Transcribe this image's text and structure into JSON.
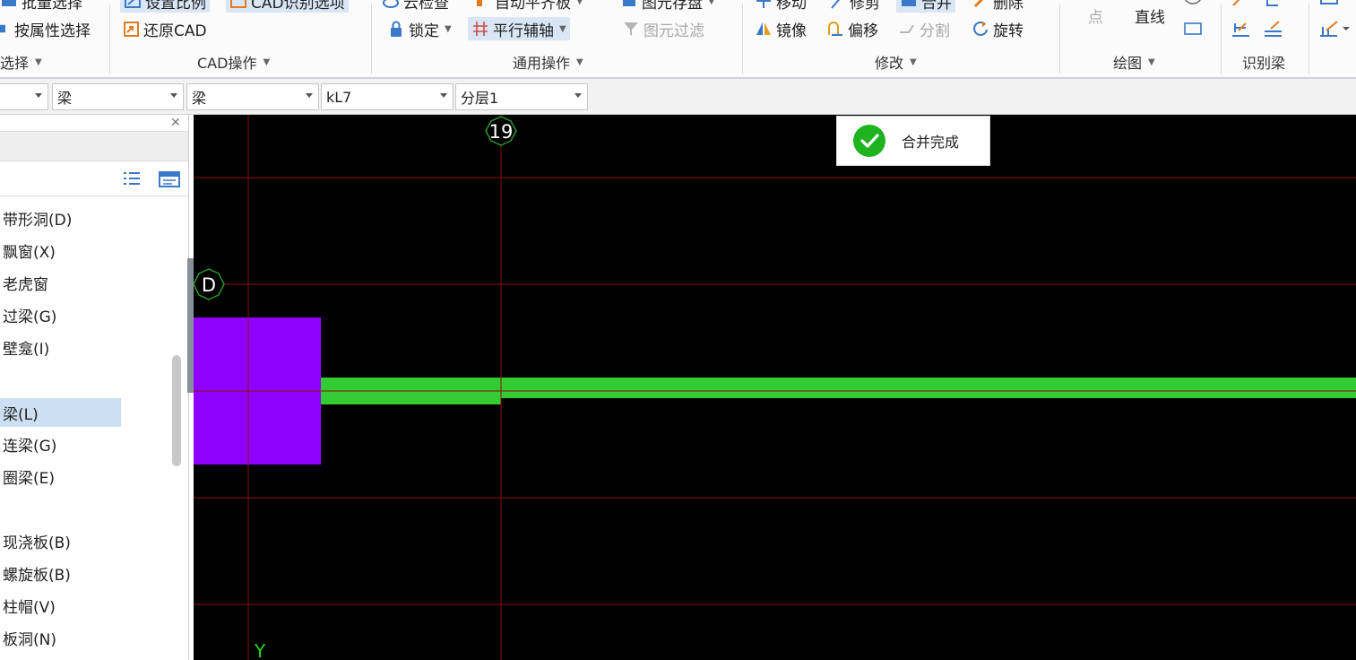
{
  "ribbon": {
    "col1": {
      "top_label": "批量选择",
      "attr_select": "按属性选择",
      "group_label": "选择"
    },
    "col2": {
      "top_label": "设置比例",
      "top_label2": "CAD识别选项",
      "restore": "还原CAD",
      "group_label": "CAD操作"
    },
    "col3": {
      "top_label": "云检查",
      "top_label2": "自动平齐板",
      "top_label3": "图元存盘",
      "lock": "锁定",
      "parallel_axis": "平行辅轴",
      "filter": "图元过滤",
      "group_label": "通用操作"
    },
    "col4": {
      "top_move": "移动",
      "top_trim": "修剪",
      "top_merge": "合并",
      "top_delete": "删除",
      "mirror": "镜像",
      "offset": "偏移",
      "split": "分割",
      "rotate": "旋转",
      "group_label": "修改"
    },
    "col5": {
      "point": "点",
      "line": "直线",
      "group_label": "绘图"
    },
    "col6": {
      "group_label": "识别梁"
    }
  },
  "toolbar2": {
    "combo1": "",
    "combo2": "梁",
    "combo3": "梁",
    "combo4": "kL7",
    "combo5": "分层1"
  },
  "panel": {
    "items": [
      {
        "label": "带形洞(D)"
      },
      {
        "label": "飘窗(X)"
      },
      {
        "label": "老虎窗"
      },
      {
        "label": "过梁(G)"
      },
      {
        "label": "壁龛(I)"
      },
      {
        "label": "梁(L)"
      },
      {
        "label": "连梁(G)"
      },
      {
        "label": "圈梁(E)"
      },
      {
        "label": "现浇板(B)"
      },
      {
        "label": "螺旋板(B)"
      },
      {
        "label": "柱帽(V)"
      },
      {
        "label": "板洞(N)"
      }
    ]
  },
  "canvas": {
    "axis_19": "19",
    "axis_D": "D",
    "axis_Y": "Y",
    "grid_color": "#8b1010",
    "column_color": "#8f00ff",
    "beam_color": "#33cc33"
  },
  "toast": {
    "message": "合并完成"
  }
}
